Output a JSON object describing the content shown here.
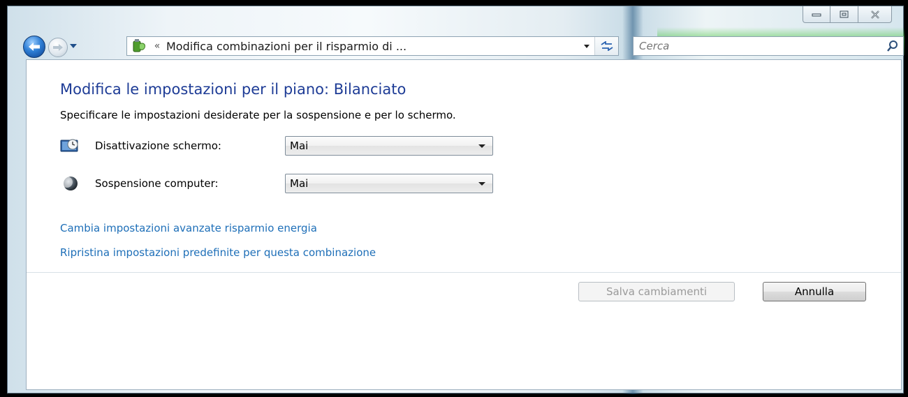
{
  "window": {
    "caption": {
      "minimize_icon": "minimize-icon",
      "maximize_icon": "maximize-icon",
      "close_icon": "close-icon"
    }
  },
  "navbar": {
    "address": {
      "chevron": "«",
      "text": "Modifica combinazioni per il risparmio di ..."
    },
    "search": {
      "placeholder": "Cerca"
    }
  },
  "main": {
    "title": "Modifica le impostazioni per il piano: Bilanciato",
    "description": "Specificare le impostazioni desiderate per la sospensione e per lo schermo.",
    "settings": [
      {
        "label": "Disattivazione schermo:",
        "value": "Mai",
        "icon": "monitor-clock-icon"
      },
      {
        "label": "Sospensione computer:",
        "value": "Mai",
        "icon": "moon-sleep-icon"
      }
    ],
    "links": {
      "advanced": "Cambia impostazioni avanzate risparmio energia",
      "restore": "Ripristina impostazioni predefinite per questa combinazione"
    },
    "buttons": {
      "save": "Salva cambiamenti",
      "cancel": "Annulla"
    }
  },
  "colors": {
    "title": "#1e3c96",
    "link": "#1e6fb8",
    "disabled_text": "#9a9a9a"
  }
}
